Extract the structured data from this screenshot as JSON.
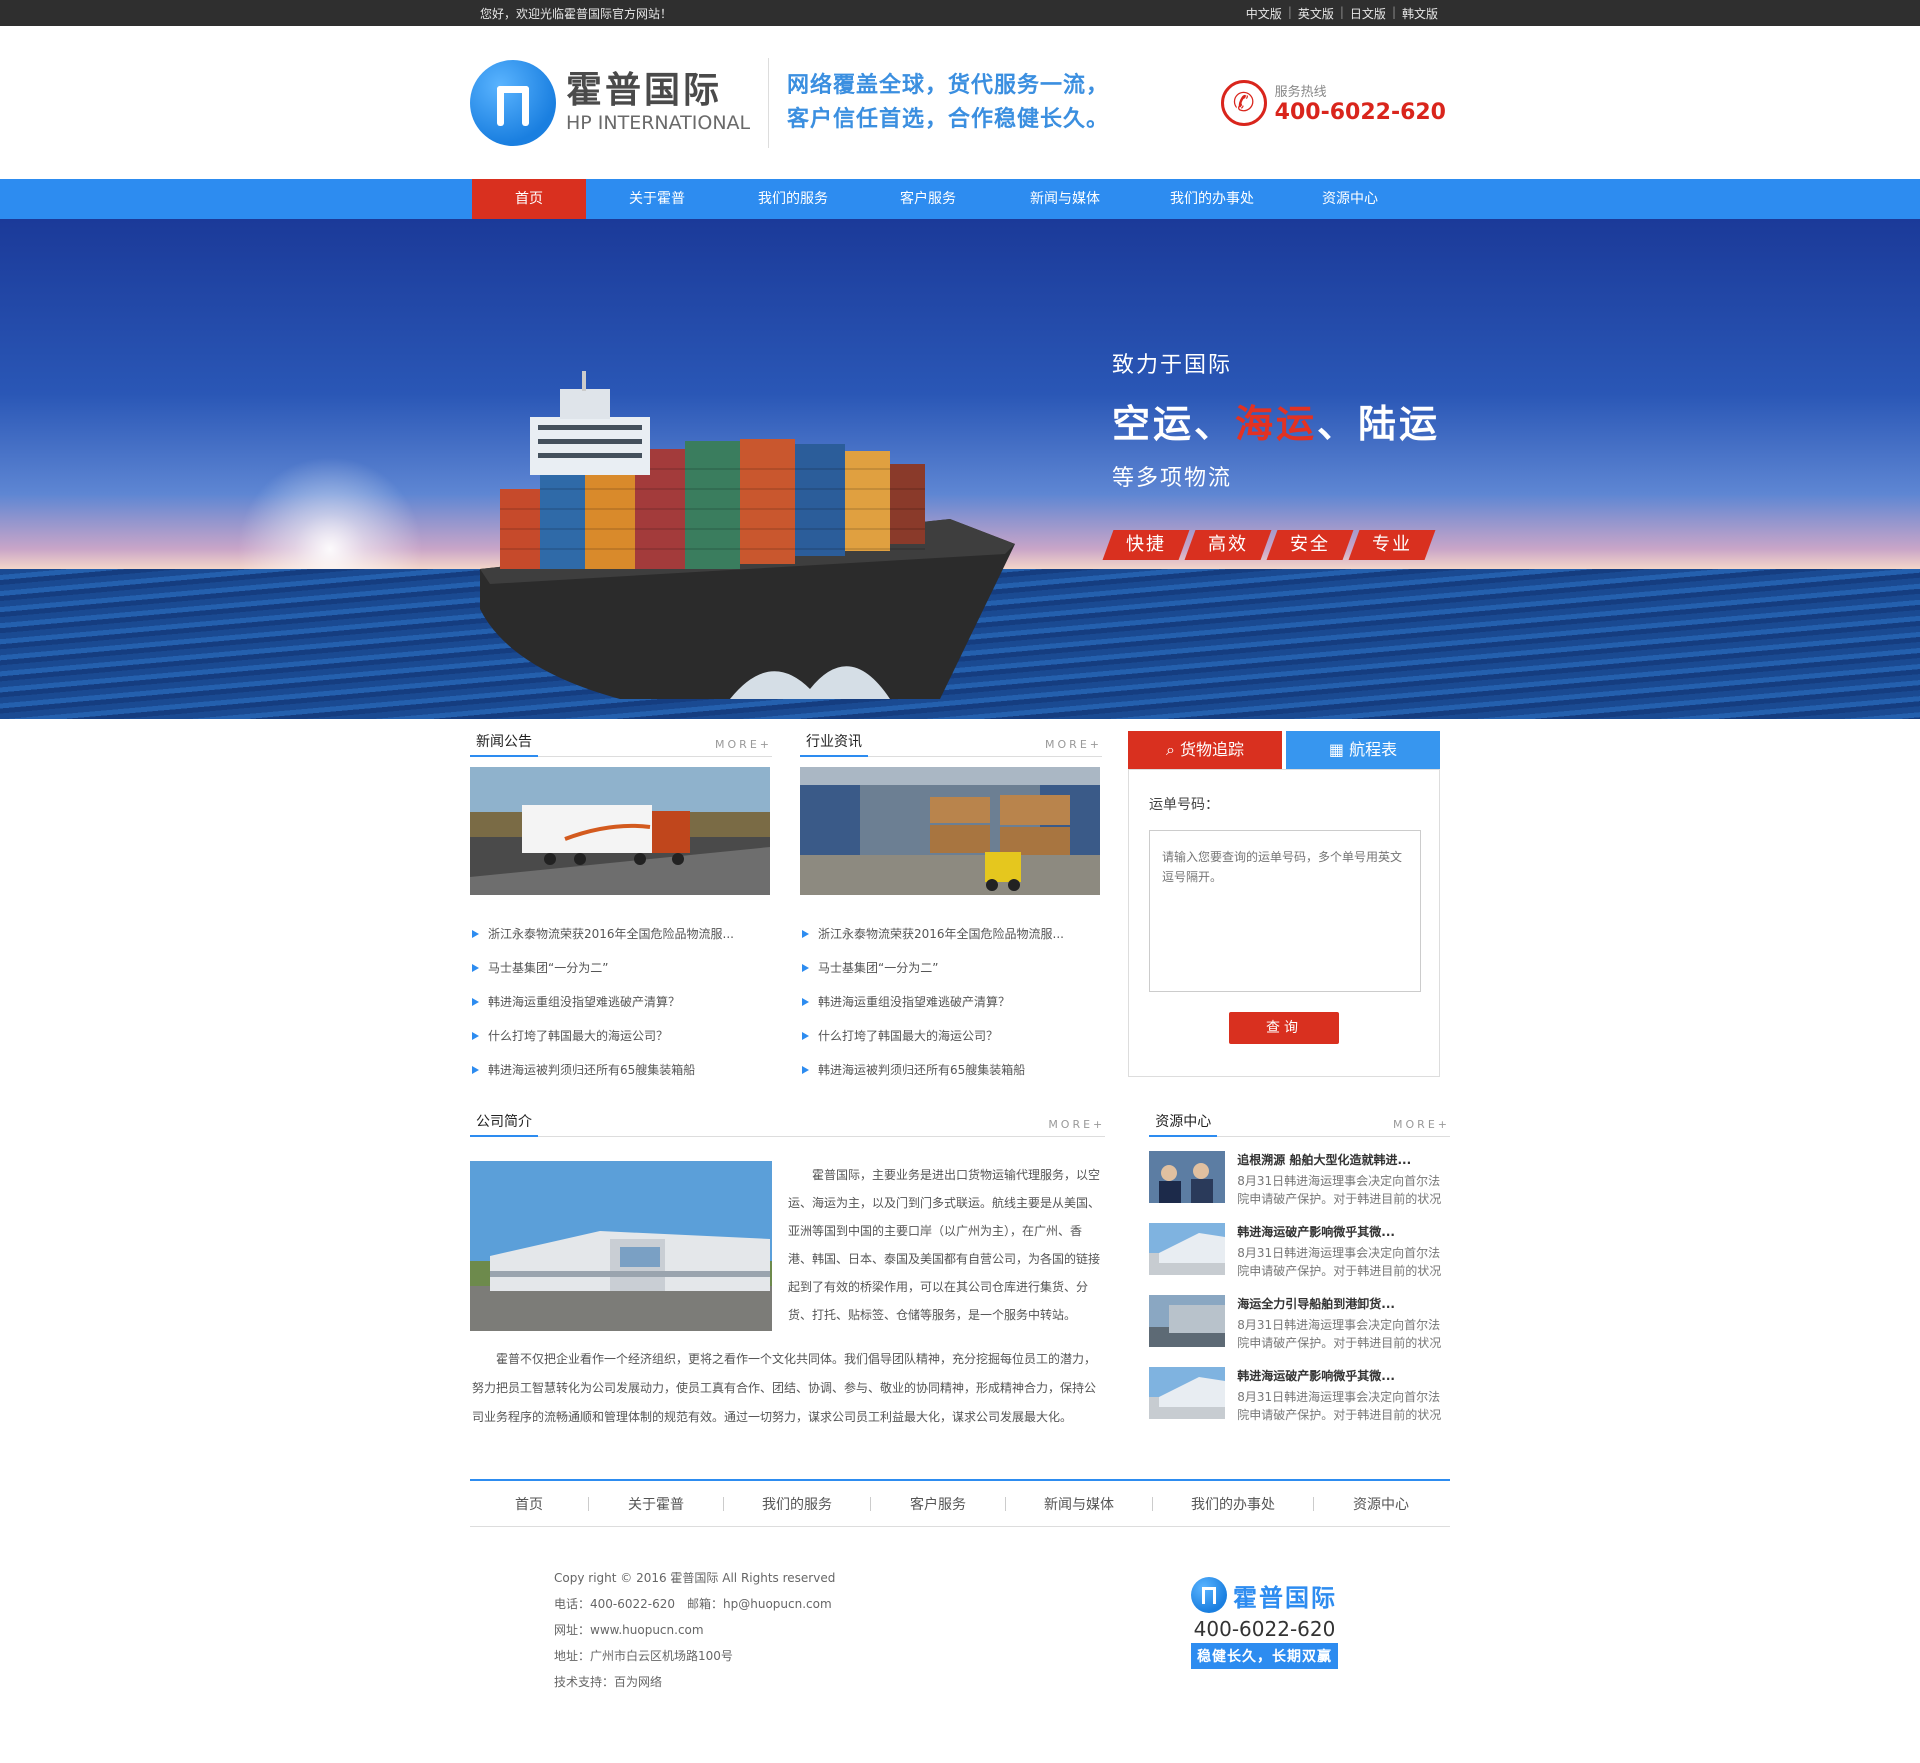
{
  "topbar": {
    "welcome": "您好，欢迎光临霍普国际官方网站！",
    "langs": [
      "中文版",
      "英文版",
      "日文版",
      "韩文版"
    ]
  },
  "header": {
    "logo_cn": "霍普国际",
    "logo_en": "HP INTERNATIONAL",
    "slogan_line1": "网络覆盖全球，货代服务一流，",
    "slogan_line2": "客户信任首选，合作稳健长久。",
    "hotline_label": "服务热线",
    "hotline_number": "400-6022-620"
  },
  "nav": {
    "items": [
      "首页",
      "关于霍普",
      "我们的服务",
      "客户服务",
      "新闻与媒体",
      "我们的办事处",
      "资源中心"
    ],
    "active_index": 0
  },
  "banner": {
    "line1": "致力于国际",
    "line2_a": "空运、",
    "line2_b": "海运",
    "line2_c": "、陆运",
    "line3": "等多项物流",
    "tags": [
      "快捷",
      "高效",
      "安全",
      "专业"
    ]
  },
  "news": {
    "title": "新闻公告",
    "more": "MORE+",
    "items": [
      "浙江永泰物流荣获2016年全国危险品物流服...",
      "马士基集团“一分为二”",
      "韩进海运重组没指望难逃破产清算？",
      "什么打垮了韩国最大的海运公司？",
      "韩进海运被判须归还所有65艘集装箱船"
    ]
  },
  "industry": {
    "title": "行业资讯",
    "more": "MORE+",
    "items": [
      "浙江永泰物流荣获2016年全国危险品物流服...",
      "马士基集团“一分为二”",
      "韩进海运重组没指望难逃破产清算？",
      "什么打垮了韩国最大的海运公司？",
      "韩进海运被判须归还所有65艘集装箱船"
    ]
  },
  "track": {
    "tab1": "货物追踪",
    "tab2": "航程表",
    "label": "运单号码：",
    "placeholder": "请输入您要查询的运单号码，多个单号用英文逗号隔开。",
    "button": "查询"
  },
  "about": {
    "title": "公司简介",
    "more": "MORE+",
    "p1": "霍普国际，主要业务是进出口货物运输代理服务，以空运、海运为主，以及门到门多式联运。航线主要是从美国、亚洲等国到中国的主要口岸（以广州为主），在广州、香港、韩国、日本、泰国及美国都有自营公司，为各国的链接起到了有效的桥梁作用，可以在其公司仓库进行集货、分货、打托、贴标签、仓储等服务，是一个服务中转站。",
    "p2": "霍普不仅把企业看作一个经济组织，更将之看作一个文化共同体。我们倡导团队精神，充分挖掘每位员工的潜力，努力把员工智慧转化为公司发展动力，使员工真有合作、团结、协调、参与、敬业的协同精神，形成精神合力，保持公司业务程序的流畅通顺和管理体制的规范有效。通过一切努力，谋求公司员工利益最大化，谋求公司发展最大化。"
  },
  "resource": {
    "title": "资源中心",
    "more": "MORE+",
    "items": [
      {
        "title": "追根溯源 船舶大型化造就韩进...",
        "desc1": "8月31日韩进海运理事会决定向首尔法",
        "desc2": "院申请破产保护。对于韩进目前的状况"
      },
      {
        "title": "韩进海运破产影响微乎其微...",
        "desc1": "8月31日韩进海运理事会决定向首尔法",
        "desc2": "院申请破产保护。对于韩进目前的状况"
      },
      {
        "title": "海运全力引导船舶到港卸货...",
        "desc1": "8月31日韩进海运理事会决定向首尔法",
        "desc2": "院申请破产保护。对于韩进目前的状况"
      },
      {
        "title": "韩进海运破产影响微乎其微...",
        "desc1": "8月31日韩进海运理事会决定向首尔法",
        "desc2": "院申请破产保护。对于韩进目前的状况"
      }
    ]
  },
  "footer_nav": [
    "首页",
    "关于霍普",
    "我们的服务",
    "客户服务",
    "新闻与媒体",
    "我们的办事处",
    "资源中心"
  ],
  "footer": {
    "copyright": "Copy right © 2016 霍普国际 All Rights reserved",
    "contact": "电话：400-6022-620　邮箱：hp@huopucn.com",
    "website": "网址：www.huopucn.com",
    "address": "地址：广州市白云区机场路100号",
    "support": "技术支持：百为网络",
    "logo_cn": "霍普国际",
    "phone": "400-6022-620",
    "slogan": "稳健长久，长期双赢"
  },
  "colors": {
    "brand_blue": "#2d8cf0",
    "accent_red": "#d9301f"
  },
  "icons": {
    "search": "search-icon",
    "calendar": "calendar-icon",
    "phone": "phone-icon"
  }
}
